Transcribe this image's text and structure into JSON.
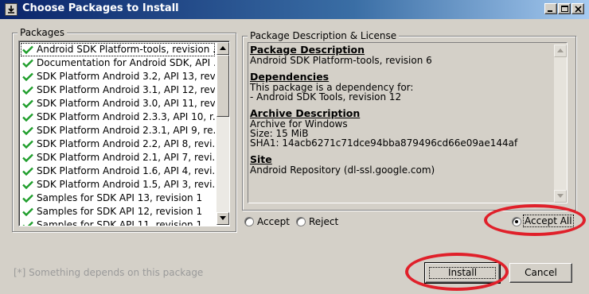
{
  "window": {
    "title": "Choose Packages to Install"
  },
  "packages": {
    "legend": "Packages",
    "items": [
      {
        "label": "Android SDK Platform-tools, revision ...",
        "checked": true,
        "selected": true
      },
      {
        "label": "Documentation for Android SDK, API ...",
        "checked": true
      },
      {
        "label": "SDK Platform Android 3.2, API 13, rev...",
        "checked": true
      },
      {
        "label": "SDK Platform Android 3.1, API 12, rev...",
        "checked": true
      },
      {
        "label": "SDK Platform Android 3.0, API 11, rev...",
        "checked": true
      },
      {
        "label": "SDK Platform Android 2.3.3, API 10, r...",
        "checked": true
      },
      {
        "label": "SDK Platform Android 2.3.1, API 9, re...",
        "checked": true
      },
      {
        "label": "SDK Platform Android 2.2, API 8, revi...",
        "checked": true
      },
      {
        "label": "SDK Platform Android 2.1, API 7, revi...",
        "checked": true
      },
      {
        "label": "SDK Platform Android 1.6, API 4, revi...",
        "checked": true
      },
      {
        "label": "SDK Platform Android 1.5, API 3, revi...",
        "checked": true
      },
      {
        "label": "Samples for SDK API 13, revision 1",
        "checked": true
      },
      {
        "label": "Samples for SDK API 12, revision 1",
        "checked": true
      },
      {
        "label": "Samples for SDK API 11, revision 1",
        "checked": true
      }
    ]
  },
  "description": {
    "legend": "Package Description & License",
    "sections": [
      {
        "title": "Package Description",
        "lines": [
          "Android SDK Platform-tools, revision 6"
        ]
      },
      {
        "title": "Dependencies",
        "lines": [
          "This package is a dependency for:",
          "- Android SDK Tools, revision 12"
        ]
      },
      {
        "title": "Archive Description",
        "lines": [
          "Archive for Windows",
          "Size: 15 MiB",
          "SHA1: 14acb6271c71dce94bba879496cd66e09ae144af"
        ]
      },
      {
        "title": "Site",
        "lines": [
          "Android Repository (dl-ssl.google.com)"
        ]
      }
    ]
  },
  "options": {
    "accept": "Accept",
    "reject": "Reject",
    "accept_all": "Accept All",
    "selected": "accept_all"
  },
  "footnote": "[*] Something depends on this package",
  "buttons": {
    "install": "Install",
    "cancel": "Cancel"
  },
  "colors": {
    "title_start": "#0a246a",
    "title_end": "#a6caf0",
    "check": "#1f9e2c",
    "highlight": "#e0202a"
  }
}
